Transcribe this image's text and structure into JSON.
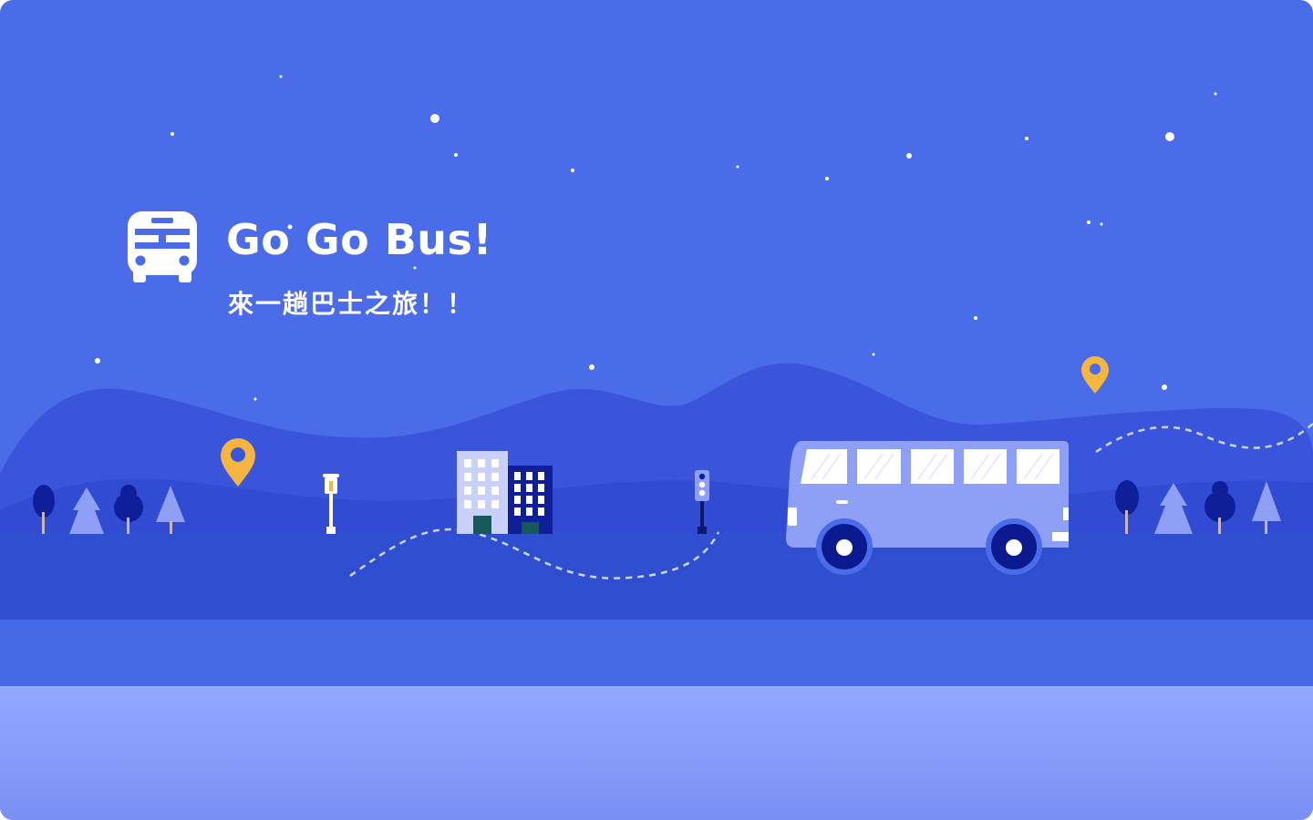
{
  "app": {
    "title": "Go Go Bus!",
    "subtitle": "來一趟巴士之旅！！"
  },
  "icons": {
    "logo": "bus-front-icon",
    "pins": "location-pin-icon"
  },
  "colors": {
    "sky": "#4a6ce8",
    "hills": "#3049d4",
    "road": "#2f4fd0",
    "road_shoulder": "#4569e6",
    "foreground": "#8aa0fa",
    "bus_body": "#8ea0f6",
    "bus_wheel": "#0b1a8f",
    "pin": "#f4b63f",
    "star": "#ffffff"
  }
}
